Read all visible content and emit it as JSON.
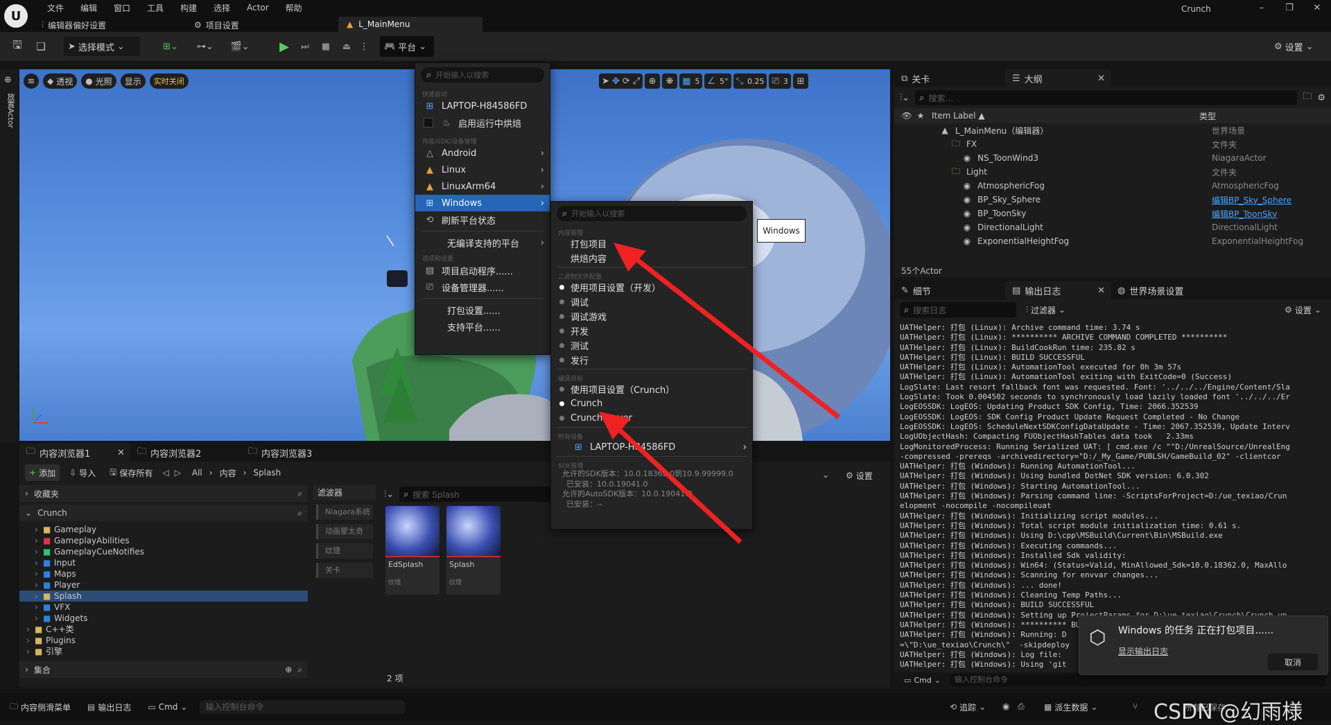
{
  "titlebar": {
    "menus": [
      "文件",
      "编辑",
      "窗口",
      "工具",
      "构建",
      "选择",
      "Actor",
      "帮助"
    ],
    "project": "Crunch",
    "tabs": [
      {
        "label": "编辑器偏好设置"
      },
      {
        "label": "项目设置"
      },
      {
        "label": "L_MainMenu"
      }
    ]
  },
  "toolbar": {
    "mode_label": "选择模式",
    "platform_label": "平台",
    "settings_label": "设置"
  },
  "viewport": {
    "perspective": "透视",
    "lit": "光照",
    "show": "显示",
    "realtime_off": "实时关闭",
    "grid_snap": "5",
    "rot_snap": "5°",
    "scale_snap": "0.25",
    "cam_speed": "3",
    "side_tab": "放置Actor"
  },
  "platform_menu": {
    "search_placeholder": "开始输入以搜索",
    "section_quick": "快速启动",
    "device": "LAPTOP-H84586FD",
    "bake_on_run": "启用运行中烘焙",
    "section_content": "内容/SDK/设备管理",
    "platforms": [
      "Android",
      "Linux",
      "LinuxArm64",
      "Windows"
    ],
    "refresh": "刷新平台状态",
    "no_compile": "无编译支持的平台",
    "section_options": "选项和设置",
    "launch_prog": "项目启动程序......",
    "device_mgr": "设备管理器......",
    "package_settings": "打包设置......",
    "supported": "支持平台......"
  },
  "windows_submenu": {
    "search_placeholder": "开始输入以搜索",
    "section_content": "内容管理",
    "package_project": "打包项目",
    "cook_content": "烘焙内容",
    "section_binary": "二进制文件配置",
    "configs": [
      "使用项目设置（开发）",
      "调试",
      "调试游戏",
      "开发",
      "测试",
      "发行"
    ],
    "section_target": "编译目标",
    "targets": [
      "使用项目设置（Crunch）",
      "Crunch",
      "CrunchServer"
    ],
    "section_devices": "所有设备",
    "device": "LAPTOP-H84586FD",
    "section_sdk": "SDK管理",
    "sdk_lines": [
      "允许的SDK版本：10.0.18362.0到10.9.99999.0",
      "已安装：10.0.19041.0",
      "允许的AutoSDK版本：10.0.19041.0",
      "已安装：--"
    ],
    "tooltip": "Windows"
  },
  "outliner": {
    "tab_level": "关卡",
    "tab_outline": "大纲",
    "search_placeholder": "搜索...",
    "col_label": "Item Label ▲",
    "col_type": "类型",
    "rows": [
      {
        "label": "L_MainMenu（编辑器）",
        "type": "世界场景",
        "indent": 1
      },
      {
        "label": "FX",
        "type": "文件夹",
        "indent": 2
      },
      {
        "label": "NS_ToonWind3",
        "type": "NiagaraActor",
        "indent": 3
      },
      {
        "label": "Light",
        "type": "文件夹",
        "indent": 2
      },
      {
        "label": "AtmosphericFog",
        "type": "AtmosphericFog",
        "indent": 3
      },
      {
        "label": "BP_Sky_Sphere",
        "type": "编辑BP_Sky_Sphere",
        "indent": 3,
        "link": true
      },
      {
        "label": "BP_ToonSky",
        "type": "编辑BP_ToonSky",
        "indent": 3,
        "link": true
      },
      {
        "label": "DirectionalLight",
        "type": "DirectionalLight",
        "indent": 3
      },
      {
        "label": "ExponentialHeightFog",
        "type": "ExponentialHeightFog",
        "indent": 3
      }
    ],
    "count": "55个Actor"
  },
  "log_panel": {
    "tab_details": "细节",
    "tab_log": "输出日志",
    "tab_world": "世界场景设置",
    "search_placeholder": "搜索日志",
    "filter": "过滤器",
    "settings": "设置",
    "lines": [
      "UATHelper: 打包 (Linux): Archive command time: 3.74 s",
      "UATHelper: 打包 (Linux): ********** ARCHIVE COMMAND COMPLETED **********",
      "UATHelper: 打包 (Linux): BuildCookRun time: 235.82 s",
      "UATHelper: 打包 (Linux): BUILD SUCCESSFUL",
      "UATHelper: 打包 (Linux): AutomationTool executed for 0h 3m 57s",
      "UATHelper: 打包 (Linux): AutomationTool exiting with ExitCode=0 (Success)",
      "LogSlate: Last resort fallback font was requested. Font: '../../../Engine/Content/Sla",
      "LogSlate: Took 0.004502 seconds to synchronously load lazily loaded font '../../../Er",
      "LogEOSSDK: LogEOS: Updating Product SDK Config, Time: 2066.352539",
      "LogEOSSDK: LogEOS: SDK Config Product Update Request Completed - No Change",
      "LogEOSSDK: LogEOS: ScheduleNextSDKConfigDataUpdate - Time: 2067.352539, Update Interv",
      "LogUObjectHash: Compacting FUObjectHashTables data took   2.33ms",
      "LogMonitoredProcess: Running Serialized UAT: [ cmd.exe /c \"\"D:/UnrealSource/UnrealEng",
      "-compressed -prereqs -archivedirectory=\"D:/_My_Game/PUBLSH/GameBuild_02\" -clientcor",
      "UATHelper: 打包 (Windows): Running AutomationTool...",
      "UATHelper: 打包 (Windows): Using bundled DotNet SDK version: 6.0.302",
      "UATHelper: 打包 (Windows): Starting AutomationTool...",
      "UATHelper: 打包 (Windows): Parsing command line: -ScriptsForProject=D:/ue_texiao/Crun",
      "elopment -nocompile -nocompileuat",
      "UATHelper: 打包 (Windows): Initializing script modules...",
      "UATHelper: 打包 (Windows): Total script module initialization time: 0.61 s.",
      "UATHelper: 打包 (Windows): Using D:\\cpp\\MSBuild\\Current\\Bin\\MSBuild.exe",
      "UATHelper: 打包 (Windows): Executing commands...",
      "UATHelper: 打包 (Windows): Installed Sdk validity:",
      "UATHelper: 打包 (Windows): Win64: (Status=Valid, MinAllowed_Sdk=10.0.18362.0, MaxAllo",
      "UATHelper: 打包 (Windows): Scanning for envvar changes...",
      "UATHelper: 打包 (Windows): ... done!",
      "UATHelper: 打包 (Windows): Cleaning Temp Paths...",
      "UATHelper: 打包 (Windows): BUILD SUCCESSFUL",
      "UATHelper: 打包 (Windows): Setting up ProjectParams for D:\\ue_texiao\\Crunch\\Crunch.up",
      "UATHelper: 打包 (Windows): ********** BUILD COMMAND STARTED **********",
      "UATHelper: 打包 (Windows): Running: D",
      "=\\\"D:\\ue_texiao\\Crunch\\\"  -skipdeploy",
      "UATHelper: 打包 (Windows): Log file:",
      "UATHelper: 打包 (Windows): Using 'git"
    ],
    "cmd": "Cmd",
    "cmd_placeholder": "输入控制台命令"
  },
  "notification": {
    "title": "Windows 的任务 正在打包项目......",
    "link": "显示输出日志",
    "cancel": "取消"
  },
  "content_browser": {
    "tabs": [
      "内容浏览器1",
      "内容浏览器2",
      "内容浏览器3"
    ],
    "add": "添加",
    "import": "导入",
    "save_all": "保存所有",
    "path": [
      "All",
      "内容",
      "Splash"
    ],
    "settings": "设置",
    "favorites": "收藏夹",
    "root": "Crunch",
    "folders": [
      "Gameplay",
      "GameplayAbilities",
      "GameplayCueNotifies",
      "Input",
      "Maps",
      "Player",
      "Splash",
      "VFX",
      "Widgets"
    ],
    "other": [
      "C++类",
      "Plugins",
      "引擎"
    ],
    "collections": "集合",
    "filters_title": "滤波器",
    "filters": [
      "Niagara系统",
      "动画蒙太奇",
      "纹理",
      "关卡"
    ],
    "search_placeholder": "搜索 Splash",
    "assets": [
      {
        "name": "EdSplash",
        "type": "纹理"
      },
      {
        "name": "Splash",
        "type": "纹理"
      }
    ],
    "count": "2 项"
  },
  "statusbar": {
    "drawer": "内容侧滑菜单",
    "log": "输出日志",
    "cmd": "Cmd",
    "cmd_placeholder": "输入控制台命令",
    "trace": "追踪",
    "derived": "派生数据",
    "save": "所有已保存",
    "watermark": "CSDN @幻雨様"
  }
}
